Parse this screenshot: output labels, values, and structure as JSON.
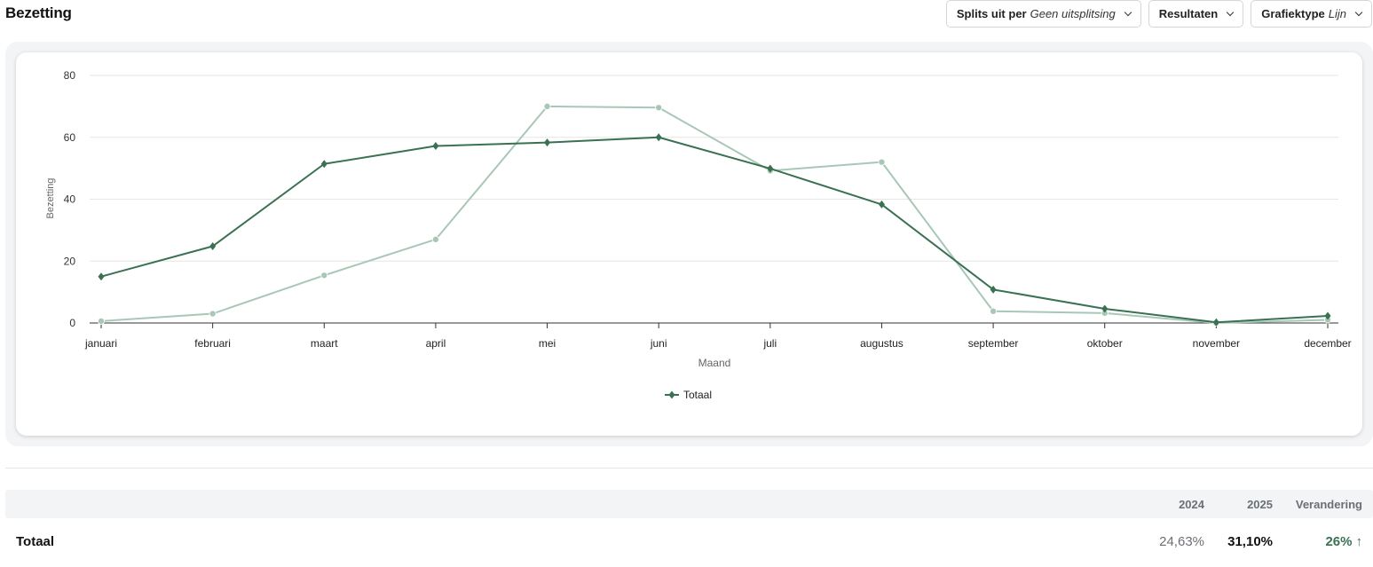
{
  "header": {
    "title": "Bezetting"
  },
  "toolbar": {
    "split": {
      "label": "Splits uit per",
      "value": "Geen uitsplitsing"
    },
    "results": {
      "label": "Resultaten"
    },
    "charttype": {
      "label": "Grafiektype",
      "value": "Lijn"
    }
  },
  "chart_data": {
    "type": "line",
    "xlabel": "Maand",
    "ylabel": "Bezetting",
    "ylim": [
      0,
      80
    ],
    "yticks": [
      0,
      20,
      40,
      60,
      80
    ],
    "grid": true,
    "legend_position": "bottom-center",
    "categories": [
      "januari",
      "februari",
      "maart",
      "april",
      "mei",
      "juni",
      "juli",
      "augustus",
      "september",
      "oktober",
      "november",
      "december"
    ],
    "series": [
      {
        "name": "Totaal",
        "color": "#3a7152",
        "marker": "diamond",
        "values": [
          15.0,
          24.8,
          51.4,
          57.2,
          58.3,
          60.0,
          49.9,
          38.3,
          10.8,
          4.6,
          0.2,
          2.3
        ]
      },
      {
        "color": "#a9c7b6",
        "marker": "circle",
        "values": [
          0.6,
          3.0,
          15.4,
          27.0,
          70.0,
          69.6,
          49.2,
          52.0,
          3.8,
          3.2,
          0.0,
          1.0
        ]
      }
    ]
  },
  "table": {
    "headers": {
      "y2024": "2024",
      "y2025": "2025",
      "change": "Verandering"
    },
    "rows": [
      {
        "label": "Totaal",
        "y2024": "24,63%",
        "y2025": "31,10%",
        "change": "26%",
        "arrow": "↑"
      }
    ]
  }
}
